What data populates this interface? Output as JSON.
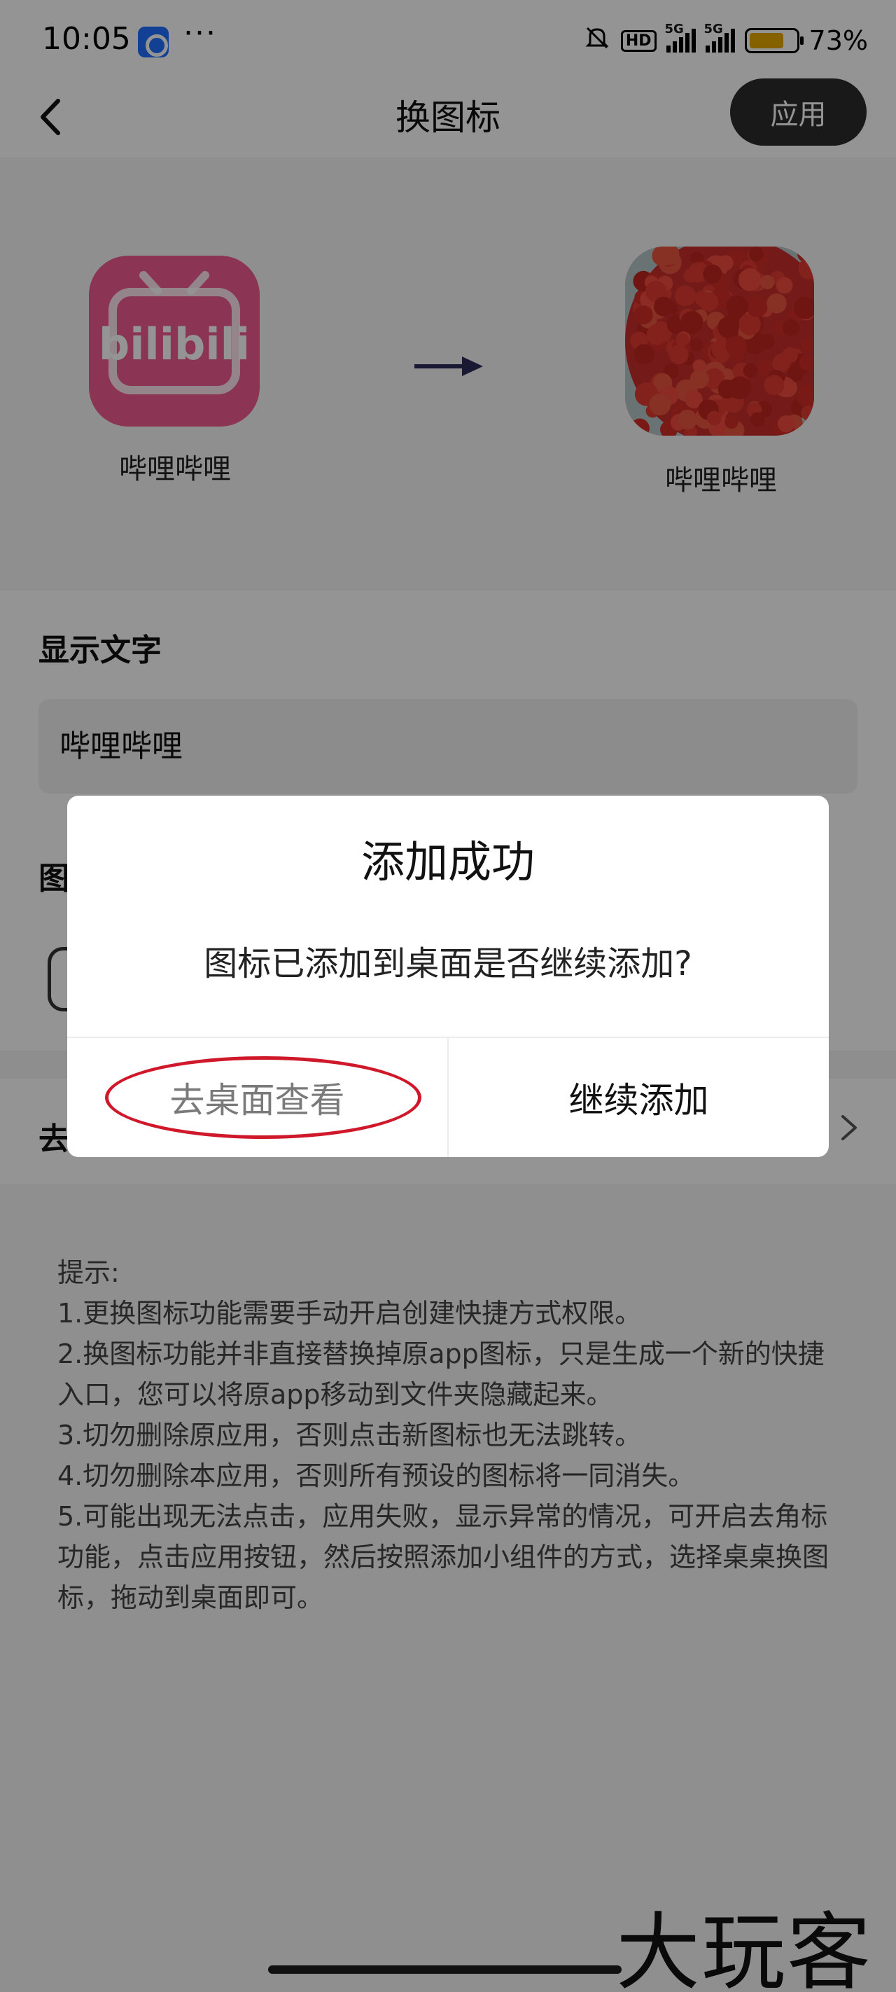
{
  "status_bar": {
    "time": "10:05",
    "dots": "···",
    "hd": "HD",
    "signal1": "5G",
    "signal2": "5G",
    "battery_level": 0.73,
    "battery_pct": "73%"
  },
  "header": {
    "title": "换图标",
    "apply_label": "应用"
  },
  "preview": {
    "original_label": "哔哩哔哩",
    "original_logo_text": "bilibili",
    "new_label": "哔哩哔哩"
  },
  "form": {
    "display_text_label": "显示文字",
    "display_text_value": "哔哩哔哩",
    "icon_label_partial": "图",
    "row_label_partial": "去"
  },
  "tips": {
    "heading": "提示:",
    "lines": [
      "1.更换图标功能需要手动开启创建快捷方式权限。",
      "2.换图标功能并非直接替换掉原app图标，只是生成一个新的快捷入口，您可以将原app移动到文件夹隐藏起来。",
      "3.切勿删除原应用，否则点击新图标也无法跳转。",
      "4.切勿删除本应用，否则所有预设的图标将一同消失。",
      "5.可能出现无法点击，应用失败，显示异常的情况，可开启去角标功能，点击应用按钮，然后按照添加小组件的方式，选择桌桌换图标，拖动到桌面即可。"
    ]
  },
  "dialog": {
    "title": "添加成功",
    "message": "图标已添加到桌面是否继续添加?",
    "left_button": "去桌面查看",
    "right_button": "继续添加"
  },
  "watermark": "大玩客",
  "colors": {
    "apply_button_bg": "#2b2b2b",
    "bilibili_pink": "#f05b8f",
    "highlight_red": "#d0182b",
    "battery_fill": "#e6a800"
  }
}
